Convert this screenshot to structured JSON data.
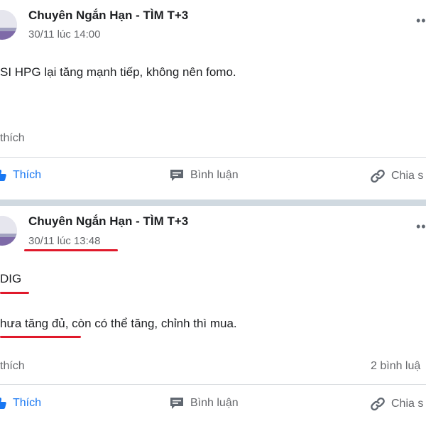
{
  "posts": [
    {
      "author": "Chuyên Ngắn Hạn - TÌM T+3",
      "timestamp": "30/11 lúc 14:00",
      "text_lines": [
        "SI HPG lại tăng mạnh tiếp, không nên fomo."
      ],
      "likes_summary": "thích",
      "comments_count": "",
      "actions": {
        "like": "Thích",
        "comment": "Bình luận",
        "share": "Chia s"
      }
    },
    {
      "author": "Chuyên Ngắn Hạn - TÌM T+3",
      "timestamp": "30/11 lúc 13:48",
      "text_lines": [
        "DIG",
        "hưa tăng đủ, còn có thể tăng, chỉnh thì mua."
      ],
      "likes_summary": "thích",
      "comments_count": "2 bình luậ",
      "actions": {
        "like": "Thích",
        "comment": "Bình luận",
        "share": "Chia s"
      }
    }
  ],
  "icons": {
    "more": "more-horizontal-icon",
    "like": "thumbs-up-icon",
    "comment": "comment-icon",
    "share": "share-link-icon"
  },
  "colors": {
    "author": "#1c1e21",
    "meta": "#65676b",
    "like_active": "#1877f2",
    "annotation_underline": "#e0192b",
    "separator": "#d0d9e0"
  }
}
